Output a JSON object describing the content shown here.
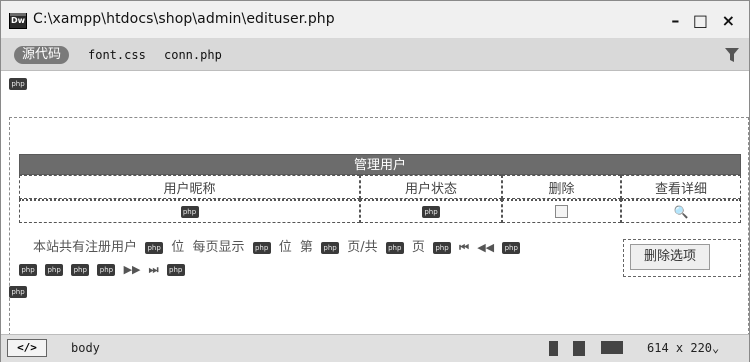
{
  "window": {
    "app_icon": "Dw",
    "title": "C:\\xampp\\htdocs\\shop\\admin\\edituser.php",
    "controls": "– □ ×"
  },
  "filesbar": {
    "source": "源代码",
    "files": [
      "font.css",
      "conn.php"
    ],
    "filter_icon": "filter-icon"
  },
  "design": {
    "php": "php",
    "table_title": "管理用户",
    "columns": [
      "用户昵称",
      "用户状态",
      "删除",
      "查看详细"
    ],
    "search_glyph": "🔍",
    "pagination": {
      "p1": "本站共有注册用户",
      "p2": "位",
      "p3": "每页显示",
      "p4": "位",
      "p5": "第",
      "p6": "页/共",
      "p7": "页",
      "first": "⏮",
      "prev": "◀◀",
      "next": "▶▶",
      "last": "⏭"
    },
    "delete_button": "删除选项"
  },
  "statusbar": {
    "code_tag": "</>",
    "body_tag": "body",
    "size": "614 x 220⌄"
  }
}
